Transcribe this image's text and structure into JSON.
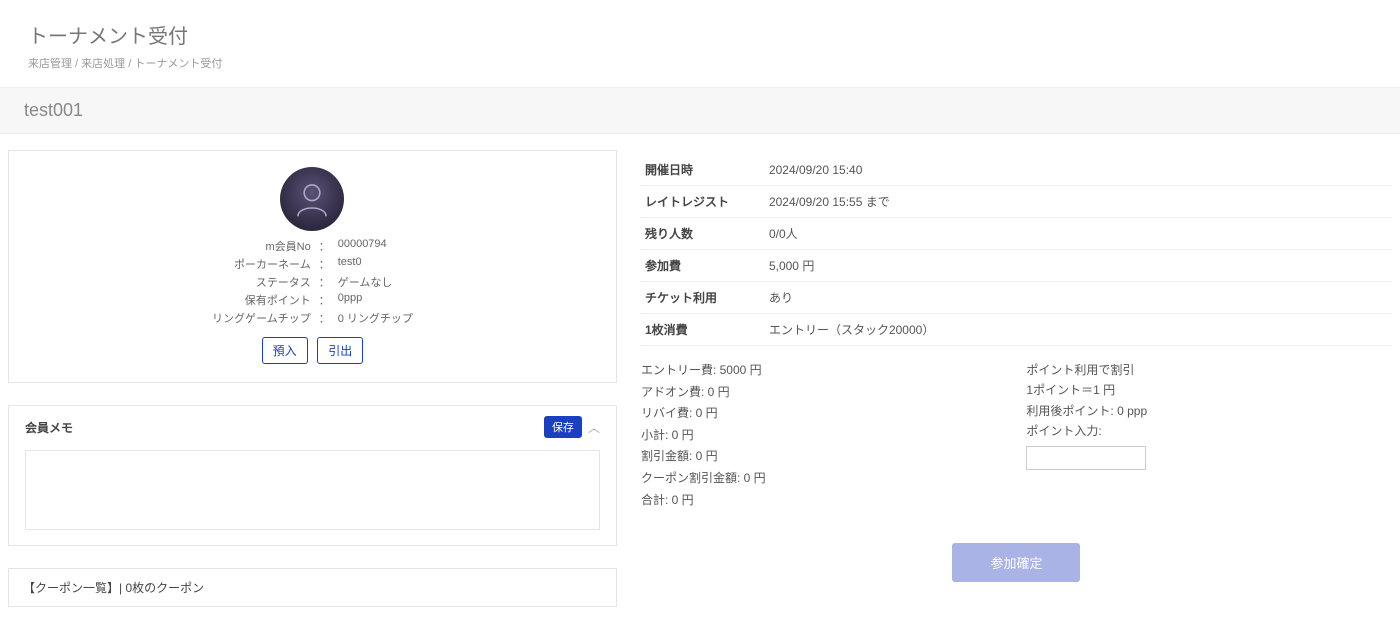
{
  "header": {
    "title": "トーナメント受付",
    "breadcrumb": "来店管理 / 来店処理 / トーナメント受付"
  },
  "sub": {
    "title": "test001"
  },
  "profile": {
    "memberNo_label": "m会員No",
    "memberNo": "00000794",
    "pokerName_label": "ポーカーネーム",
    "pokerName": "test0",
    "status_label": "ステータス",
    "status": "ゲームなし",
    "points_label": "保有ポイント",
    "points": "0ppp",
    "ringChip_label": "リングゲームチップ",
    "ringChip": "0 リングチップ"
  },
  "buttons": {
    "deposit": "預入",
    "withdraw": "引出",
    "save": "保存",
    "confirm": "参加確定"
  },
  "memo": {
    "title": "会員メモ",
    "value": ""
  },
  "coupon": {
    "title": "【クーポン一覧】| 0枚のクーポン"
  },
  "details": {
    "date_label": "開催日時",
    "date": "2024/09/20 15:40",
    "lateReg_label": "レイトレジスト",
    "lateReg": "2024/09/20 15:55 まで",
    "remain_label": "残り人数",
    "remain": "0/0人",
    "fee_label": "参加費",
    "fee": "5,000 円",
    "ticket_label": "チケット利用",
    "ticket": "あり",
    "consume_label": "1枚消費",
    "consume": "エントリー（スタック20000）"
  },
  "fees": {
    "entry": "エントリー費: 5000 円",
    "addon": "アドオン費: 0 円",
    "rebuy": "リバイ費: 0 円",
    "subtotal": "小計: 0 円",
    "discount": "割引金額: 0 円",
    "couponDiscount": "クーポン割引金額: 0 円",
    "total": "合計: 0 円"
  },
  "points": {
    "line1": "ポイント利用で割引",
    "line2": "1ポイント＝1 円",
    "line3": "利用後ポイント: 0 ppp",
    "inputLabel": "ポイント入力:",
    "inputValue": ""
  }
}
